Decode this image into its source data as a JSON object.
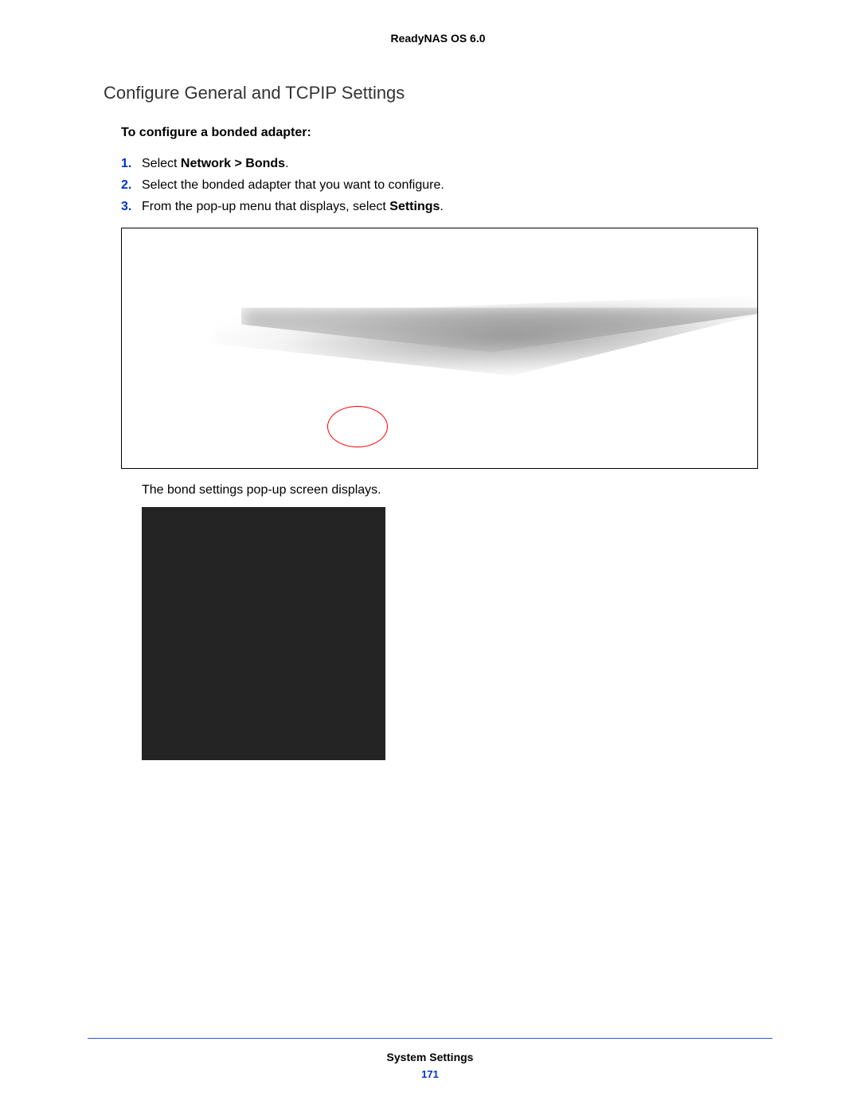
{
  "header": {
    "product": "ReadyNAS OS 6.0"
  },
  "section": {
    "title": "Configure General and TCPIP Settings",
    "subheading": "To configure a bonded adapter:"
  },
  "steps": [
    {
      "num": "1.",
      "prefix": "Select ",
      "bold": "Network > Bonds",
      "suffix": "."
    },
    {
      "num": "2.",
      "prefix": "Select the bonded adapter that you want to configure.",
      "bold": "",
      "suffix": ""
    },
    {
      "num": "3.",
      "prefix": "From the pop-up menu that displays, select ",
      "bold": "Settings",
      "suffix": "."
    }
  ],
  "caption": "The bond settings pop-up screen displays.",
  "footer": {
    "section": "System Settings",
    "page": "171"
  }
}
